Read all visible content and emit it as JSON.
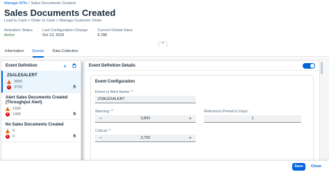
{
  "breadcrumb": {
    "link": "Manage KPIs",
    "separator": "/",
    "current": "Sales Documents Created"
  },
  "header": {
    "title": "Sales Documents Created",
    "subtitle": "Lead to Cash > Order to Cash > Manage Customer Order",
    "kpis": [
      {
        "label": "Activation Status",
        "value": "Active"
      },
      {
        "label": "Last Configuration Change",
        "value": "Oct 13, 2023"
      },
      {
        "label": "Current Global Value",
        "value": "3,788"
      }
    ]
  },
  "tabs": [
    "Information",
    "Events",
    "Data Collection"
  ],
  "left_panel": {
    "title": "Event Definition",
    "add_icon": "plus-icon",
    "delete_icon": "trash-icon",
    "items": [
      {
        "name": "ZSALESALERT",
        "warning": "3800",
        "critical": "3750"
      },
      {
        "name": "Alert Sales Documents Created (Throughput Alert)",
        "warning": "1500",
        "critical": "1400"
      },
      {
        "name": "No Sales Documents Created",
        "warning": "5",
        "critical": "0"
      }
    ]
  },
  "right_panel": {
    "title": "Event Definition Details",
    "toggle_state": "on",
    "card": {
      "title": "Event Configuration",
      "name_label": "Event or Alert Name:",
      "name_value": "ZSALESALERT",
      "warning_label": "Warning:",
      "warning_value": "3,800",
      "reference_label": "Reference Period in Days:",
      "reference_value": "1",
      "critical_label": "Critical:",
      "critical_value": "3,750",
      "minus": "−",
      "plus": "+",
      "required": "*"
    }
  },
  "footer": {
    "save_label": "Save",
    "close_label": "Close"
  },
  "colors": {
    "accent": "#0064d9",
    "critical": "#d20a0a",
    "warning": "#e76500",
    "positive": "#256f3a"
  }
}
